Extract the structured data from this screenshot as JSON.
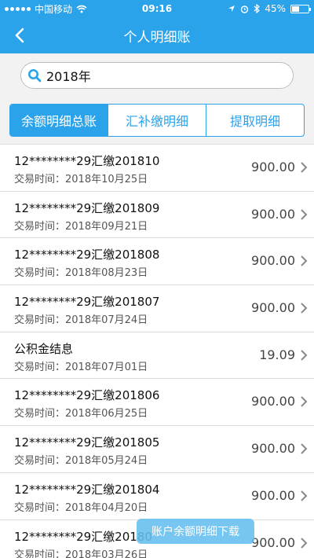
{
  "status": {
    "carrier": "中国移动",
    "time": "09:16",
    "battery": "45%"
  },
  "nav": {
    "title": "个人明细账"
  },
  "search": {
    "value": "2018年"
  },
  "tabs": [
    {
      "label": "余额明细总账"
    },
    {
      "label": "汇补缴明细"
    },
    {
      "label": "提取明细"
    }
  ],
  "list": {
    "date_prefix": "交易时间：",
    "items": [
      {
        "title": "12********29汇缴201810",
        "date": "2018年10月25日",
        "amount": "900.00"
      },
      {
        "title": "12********29汇缴201809",
        "date": "2018年09月21日",
        "amount": "900.00"
      },
      {
        "title": "12********29汇缴201808",
        "date": "2018年08月23日",
        "amount": "900.00"
      },
      {
        "title": "12********29汇缴201807",
        "date": "2018年07月24日",
        "amount": "900.00"
      },
      {
        "title": "公积金结息",
        "date": "2018年07月01日",
        "amount": "19.09"
      },
      {
        "title": "12********29汇缴201806",
        "date": "2018年06月25日",
        "amount": "900.00"
      },
      {
        "title": "12********29汇缴201805",
        "date": "2018年05月24日",
        "amount": "900.00"
      },
      {
        "title": "12********29汇缴201804",
        "date": "2018年04月20日",
        "amount": "900.00"
      },
      {
        "title": "12********29汇缴20180",
        "date": "2018年03月26日",
        "amount": "900.00"
      }
    ]
  },
  "download": {
    "label": "账户余额明细下载"
  },
  "colors": {
    "primary": "#2aa3ea",
    "background": "#f2f2f2"
  }
}
